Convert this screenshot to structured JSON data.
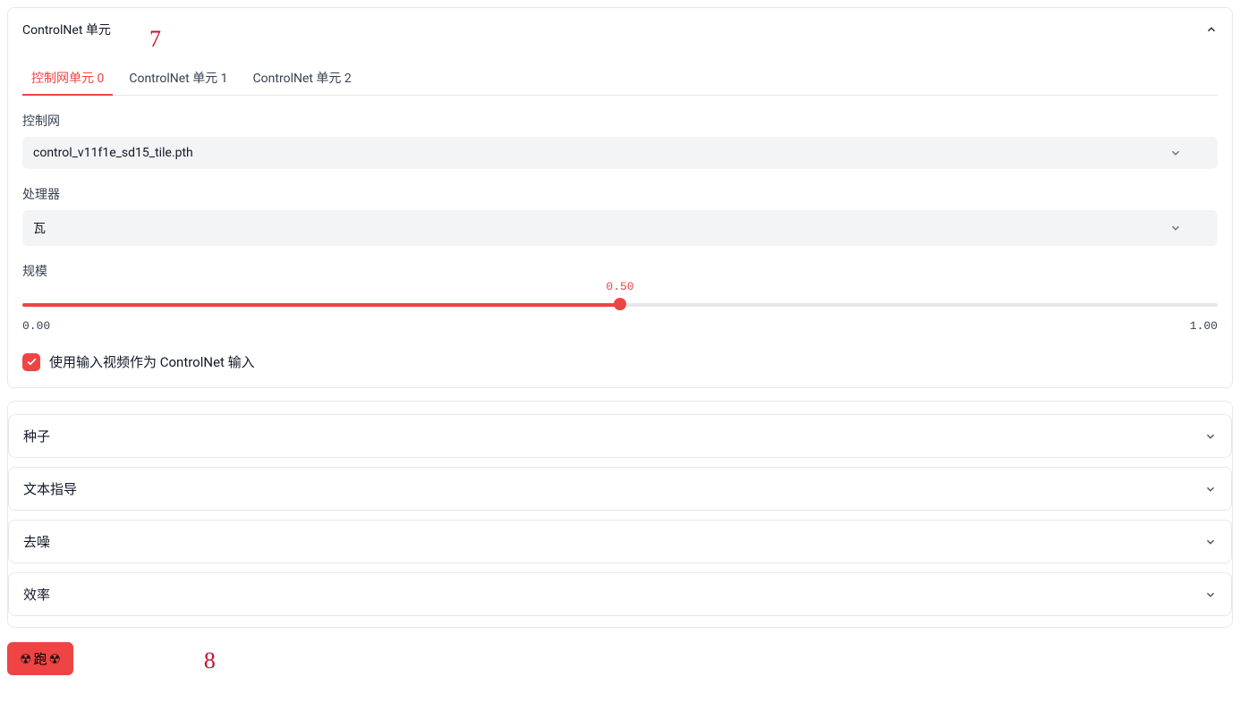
{
  "controlnet_panel": {
    "title": "ControlNet 单元",
    "annot": "7",
    "tabs": [
      {
        "label": "控制网单元 0",
        "active": true
      },
      {
        "label": "ControlNet 单元 1",
        "active": false
      },
      {
        "label": "ControlNet 单元 2",
        "active": false
      }
    ],
    "model": {
      "label": "控制网",
      "value": "control_v11f1e_sd15_tile.pth"
    },
    "preprocessor": {
      "label": "处理器",
      "value": "瓦"
    },
    "scale": {
      "label": "规模",
      "value_text": "0.50",
      "min_text": "0.00",
      "max_text": "1.00",
      "percent": 50
    },
    "checkbox": {
      "checked": true,
      "label": "使用输入视频作为 ControlNet 输入"
    }
  },
  "accordions": [
    {
      "label": "种子"
    },
    {
      "label": "文本指导"
    },
    {
      "label": "去噪"
    },
    {
      "label": "效率"
    }
  ],
  "run": {
    "emoji": "☢",
    "label": "跑",
    "annot": "8"
  }
}
